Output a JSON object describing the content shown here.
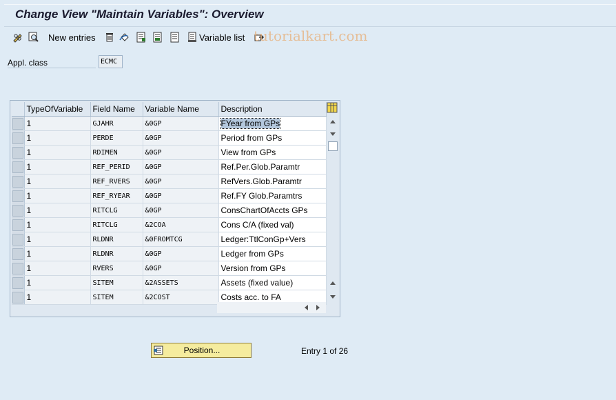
{
  "title": "Change View \"Maintain Variables\": Overview",
  "toolbar": {
    "new_entries": "New entries",
    "variable_list": "Variable list"
  },
  "watermark": "tutorialkart.com",
  "appl_class": {
    "label": "Appl. class",
    "value": "ECMC"
  },
  "table": {
    "columns": [
      "TypeOfVariable",
      "Field Name",
      "Variable Name",
      "Description"
    ],
    "rows": [
      {
        "type": "1",
        "field": "GJAHR",
        "variable": "&0GP",
        "desc": "FYear from GPs"
      },
      {
        "type": "1",
        "field": "PERDE",
        "variable": "&0GP",
        "desc": "Period from GPs"
      },
      {
        "type": "1",
        "field": "RDIMEN",
        "variable": "&0GP",
        "desc": "View from GPs"
      },
      {
        "type": "1",
        "field": "REF_PERID",
        "variable": "&0GP",
        "desc": "Ref.Per.Glob.Paramtr"
      },
      {
        "type": "1",
        "field": "REF_RVERS",
        "variable": "&0GP",
        "desc": "RefVers.Glob.Paramtr"
      },
      {
        "type": "1",
        "field": "REF_RYEAR",
        "variable": "&0GP",
        "desc": "Ref.FY Glob.Paramtrs"
      },
      {
        "type": "1",
        "field": "RITCLG",
        "variable": "&0GP",
        "desc": "ConsChartOfAccts GPs"
      },
      {
        "type": "1",
        "field": "RITCLG",
        "variable": "&2COA",
        "desc": "Cons C/A (fixed val)"
      },
      {
        "type": "1",
        "field": "RLDNR",
        "variable": "&0FROMTCG",
        "desc": "Ledger:TtlConGp+Vers"
      },
      {
        "type": "1",
        "field": "RLDNR",
        "variable": "&0GP",
        "desc": "Ledger from GPs"
      },
      {
        "type": "1",
        "field": "RVERS",
        "variable": "&0GP",
        "desc": "Version from GPs"
      },
      {
        "type": "1",
        "field": "SITEM",
        "variable": "&2ASSETS",
        "desc": "Assets (fixed value)"
      },
      {
        "type": "1",
        "field": "SITEM",
        "variable": "&2COST",
        "desc": "Costs acc. to FA"
      }
    ]
  },
  "position_button": "Position...",
  "entry_info": "Entry 1 of 26",
  "colors": {
    "background": "#dfebf5",
    "button": "#f5ec9e",
    "highlight": "#b3c7dd"
  }
}
